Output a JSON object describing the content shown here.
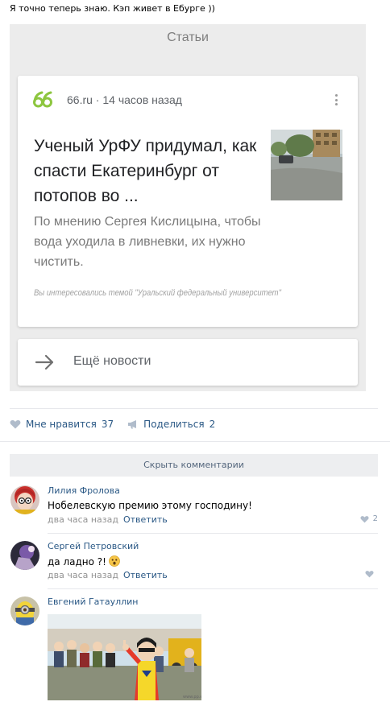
{
  "post": {
    "text": "Я точно теперь знаю. Кэп живет в Ебурге ))"
  },
  "screenshot": {
    "section_title": "Статьи",
    "article": {
      "source": "66.ru · 14 часов назад",
      "headline": "Ученый УрФУ придумал, как спасти Екатеринбург от потопов во ...",
      "summary": "По мнению Сергея Кислицына, чтобы вода уходила в ливневки, их нужно чистить.",
      "reason": "Вы интересовались темой \"Уральский федеральный университет\""
    },
    "more_news_label": "Ещё новости"
  },
  "actions": {
    "like_label": "Мне нравится",
    "like_count": "37",
    "share_label": "Поделиться",
    "share_count": "2"
  },
  "comments_toggle": "Скрыть комментарии",
  "comments": [
    {
      "author": "Лилия Фролова",
      "text": "Нобелевскую премию этому господину!",
      "time": "два часа назад",
      "reply": "Ответить",
      "likes": "2"
    },
    {
      "author": "Сергей Петровский",
      "text": "да ладно ?!",
      "time": "два часа назад",
      "reply": "Ответить",
      "likes": ""
    },
    {
      "author": "Евгений Гатауллин"
    }
  ],
  "colors": {
    "link": "#2a5885",
    "meta": "#939393",
    "screenshot_bg": "#ececec",
    "logo_green": "#8dc63f"
  }
}
